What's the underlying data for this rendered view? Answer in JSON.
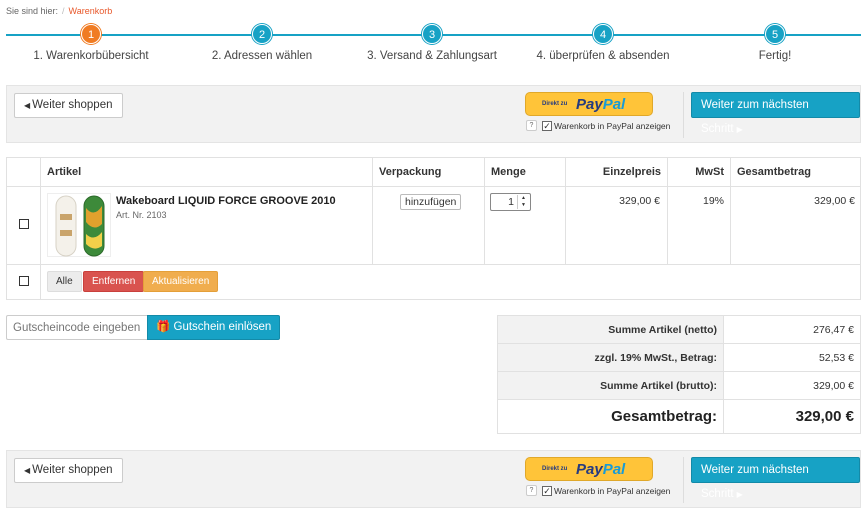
{
  "breadcrumb": {
    "prefix": "Sie sind hier:",
    "separator": "/",
    "current": "Warenkorb"
  },
  "steps": [
    {
      "num": "1",
      "label": "1. Warenkorbübersicht",
      "active": true
    },
    {
      "num": "2",
      "label": "2. Adressen wählen",
      "active": false
    },
    {
      "num": "3",
      "label": "3. Versand & Zahlungsart",
      "active": false
    },
    {
      "num": "4",
      "label": "4. überprüfen & absenden",
      "active": false
    },
    {
      "num": "5",
      "label": "Fertig!",
      "active": false
    }
  ],
  "toolbar": {
    "back_label": "Weiter shoppen",
    "paypal_prefix": "Direkt zu",
    "paypal_pay": "Pay",
    "paypal_pal": "Pal",
    "paypal_help": "?",
    "paypal_checkbox_label": "Warenkorb in PayPal anzeigen",
    "paypal_checked": true,
    "next_label": "Weiter zum nächsten Schritt"
  },
  "cart": {
    "headers": {
      "article": "Artikel",
      "packaging": "Verpackung",
      "quantity": "Menge",
      "unit_price": "Einzelpreis",
      "vat": "MwSt",
      "total": "Gesamtbetrag"
    },
    "items": [
      {
        "name": "Wakeboard LIQUID FORCE GROOVE 2010",
        "article_nr": "Art. Nr. 2103",
        "packaging_button": "hinzufügen",
        "quantity": "1",
        "unit_price": "329,00 €",
        "vat": "19%",
        "total": "329,00 €"
      }
    ],
    "actions": {
      "all": "Alle",
      "remove": "Entfernen",
      "update": "Aktualisieren"
    }
  },
  "coupon": {
    "placeholder": "Gutscheincode eingeben",
    "button": "Gutschein einlösen"
  },
  "totals": [
    {
      "label": "Summe Artikel (netto)",
      "value": "276,47 €"
    },
    {
      "label": "zzgl. 19% MwSt., Betrag:",
      "value": "52,53 €"
    },
    {
      "label": "Summe Artikel (brutto):",
      "value": "329,00 €"
    }
  ],
  "grand_total": {
    "label": "Gesamtbetrag:",
    "value": "329,00 €"
  },
  "colors": {
    "accent": "#17a2c5",
    "active_step": "#f07b22",
    "danger": "#d9534f",
    "warning": "#f0ad4e",
    "paypal_yellow": "#ffc439"
  }
}
